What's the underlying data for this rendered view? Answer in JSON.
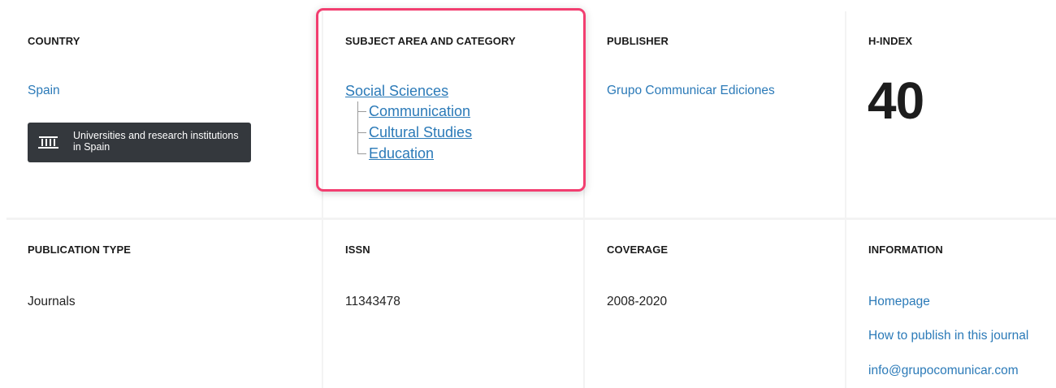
{
  "country": {
    "heading": "COUNTRY",
    "value": "Spain",
    "badge_text": "Universities and research institutions in Spain"
  },
  "subject": {
    "heading": "SUBJECT AREA AND CATEGORY",
    "area": "Social Sciences",
    "categories": [
      "Communication",
      "Cultural Studies",
      "Education"
    ]
  },
  "publisher": {
    "heading": "PUBLISHER",
    "value": "Grupo Communicar Ediciones"
  },
  "hindex": {
    "heading": "H-INDEX",
    "value": "40"
  },
  "publication_type": {
    "heading": "PUBLICATION TYPE",
    "value": "Journals"
  },
  "issn": {
    "heading": "ISSN",
    "value": "11343478"
  },
  "coverage": {
    "heading": "COVERAGE",
    "value": "2008-2020"
  },
  "information": {
    "heading": "INFORMATION",
    "links": [
      "Homepage",
      "How to publish in this journal",
      "info@grupocomunicar.com"
    ]
  },
  "colors": {
    "link": "#2b7ab8",
    "highlight": "#f23e70",
    "badge_bg": "#34383d"
  }
}
